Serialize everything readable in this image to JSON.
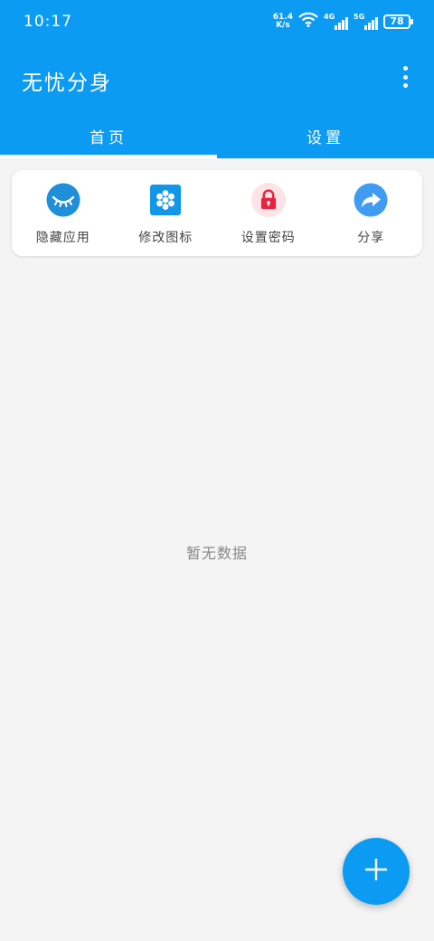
{
  "status_bar": {
    "time": "10:17",
    "net_speed_value": "61.4",
    "net_speed_unit": "K/s",
    "signal_1_label": "4G",
    "signal_2_label": "5G",
    "battery": "78"
  },
  "app_bar": {
    "title": "无忧分身"
  },
  "tabs": [
    {
      "label": "首页",
      "active": true
    },
    {
      "label": "设置",
      "active": false
    }
  ],
  "actions": [
    {
      "label": "隐藏应用",
      "icon": "eye-closed-icon",
      "color": "#1e8fd8"
    },
    {
      "label": "修改图标",
      "icon": "grid-icon",
      "color": "#1296e6"
    },
    {
      "label": "设置密码",
      "icon": "lock-icon",
      "color": "#e8233f"
    },
    {
      "label": "分享",
      "icon": "share-icon",
      "color": "#3f9cf2"
    }
  ],
  "empty_state": {
    "text": "暂无数据"
  },
  "fab": {
    "icon": "plus-icon"
  },
  "colors": {
    "primary": "#0c9bf3",
    "background": "#f4f4f4"
  }
}
